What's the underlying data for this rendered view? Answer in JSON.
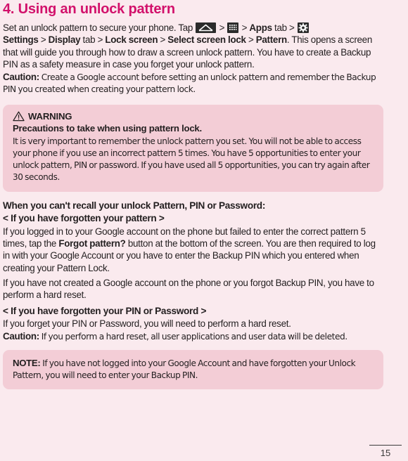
{
  "theme": {
    "page_bg": "#faeaee",
    "callout_bg": "#f3cdd6",
    "title_color": "#d2116b",
    "text_color": "#231f20"
  },
  "title": "4. Using an unlock pattern",
  "intro": {
    "part1": "Set an unlock pattern to secure your phone. Tap ",
    "sep": " > ",
    "apps_bold": "Apps",
    "apps_tail": " tab > ",
    "settings_bold": "Settings",
    "after_settings": " > ",
    "display_bold": "Display",
    "display_tail": " tab > ",
    "lock_screen_bold": "Lock screen",
    "lock_tail": " > ",
    "select_lock_bold": "Select screen lock",
    "select_tail": " > ",
    "pattern_bold": "Pattern",
    "tail": ". This opens a screen that will guide you through how to draw a screen unlock pattern. You have to create a Backup PIN as a safety measure in case you forget your unlock pattern."
  },
  "icons": {
    "home": "home-icon",
    "apps_grid": "apps-grid-icon",
    "gear": "gear-icon",
    "warning_triangle": "warning-triangle-icon"
  },
  "caution_top": {
    "lead": "Caution:",
    "text": " Create a Google account before setting an unlock pattern and remember the Backup PIN you created when creating your pattern lock."
  },
  "warning_box": {
    "heading": "WARNING",
    "subheading": "Precautions to take when using pattern lock.",
    "body": "It is very important to remember the unlock pattern you set. You will not be able to access your phone if you use an incorrect pattern 5 times. You have 5 opportunities to enter your unlock pattern, PIN or password. If you have used all 5 opportunities, you can try again after 30 seconds."
  },
  "recall_section": {
    "heading": "When you can't recall your unlock Pattern, PIN or Password:",
    "sub1": "< If you have forgotten your pattern >",
    "p1_a": "If you logged in to your Google account on the phone but failed to enter the correct pattern 5 times, tap the ",
    "p1_bold": "Forgot pattern?",
    "p1_b": " button at the bottom of the screen. You are then required to log in with your Google Account or you have to enter the Backup PIN which you entered when creating your Pattern Lock.",
    "p2": "If you have not created a Google account on the phone or you forgot Backup PIN, you have to perform a hard reset.",
    "sub2": "< If you have forgotten your PIN or Password >",
    "p3": "If you forget your PIN or Password, you will need to perform a hard reset.",
    "caution_lead": "Caution:",
    "caution_text": " If you perform a hard reset, all user applications and user data will be deleted."
  },
  "note_box": {
    "lead": "NOTE:",
    "text": " If you have not logged into your Google Account and have forgotten your Unlock Pattern, you will need to enter your Backup PIN."
  },
  "footer": {
    "page_number": "15"
  }
}
